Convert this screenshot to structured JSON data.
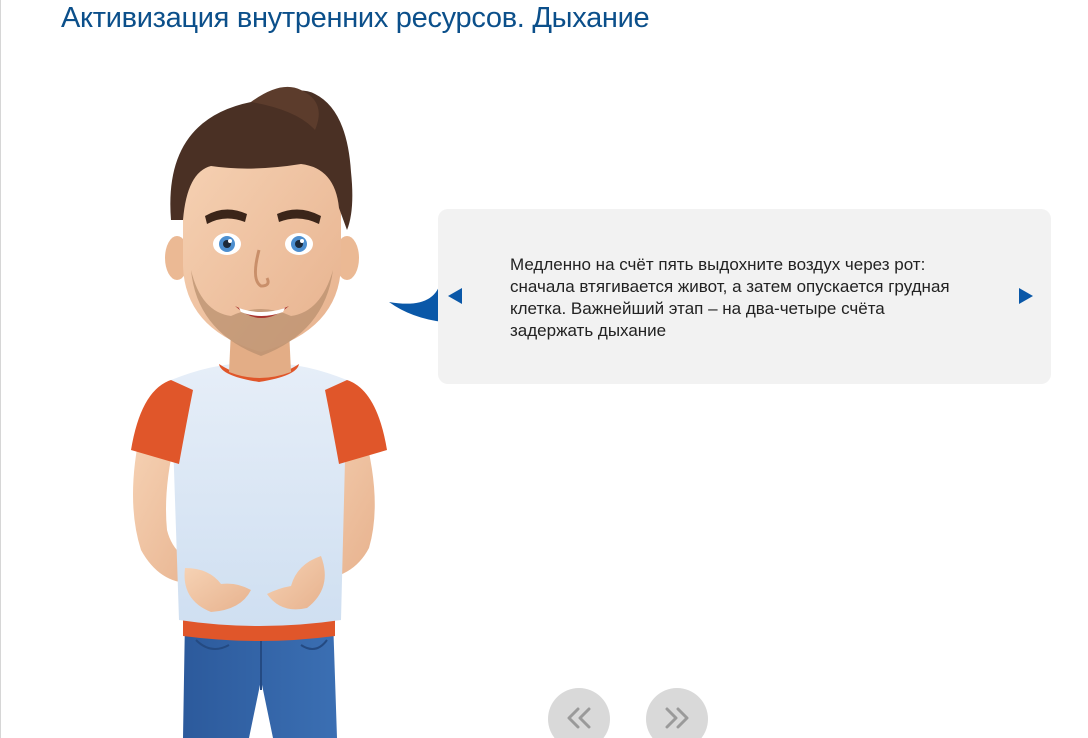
{
  "page": {
    "title": "Активизация внутренних ресурсов. Дыхание"
  },
  "bubble": {
    "text": "Медленно на счёт пять выдохните воздух через рот: сначала втягивается живот, а затем опускается грудная клетка. Важнейший этап – на два-четыре счёта задержать дыхание",
    "prev_icon": "triangle-left-icon",
    "next_icon": "triangle-right-icon"
  },
  "navigation": {
    "back_icon": "double-chevron-left-icon",
    "forward_icon": "double-chevron-right-icon"
  },
  "colors": {
    "title": "#0b4f8a",
    "accent_blue": "#0a58a8",
    "bubble_bg": "#f2f2f2",
    "nav_button": "#d9d9d9",
    "nav_icon": "#9a9a9a",
    "shirt_sleeve": "#e0562a"
  }
}
